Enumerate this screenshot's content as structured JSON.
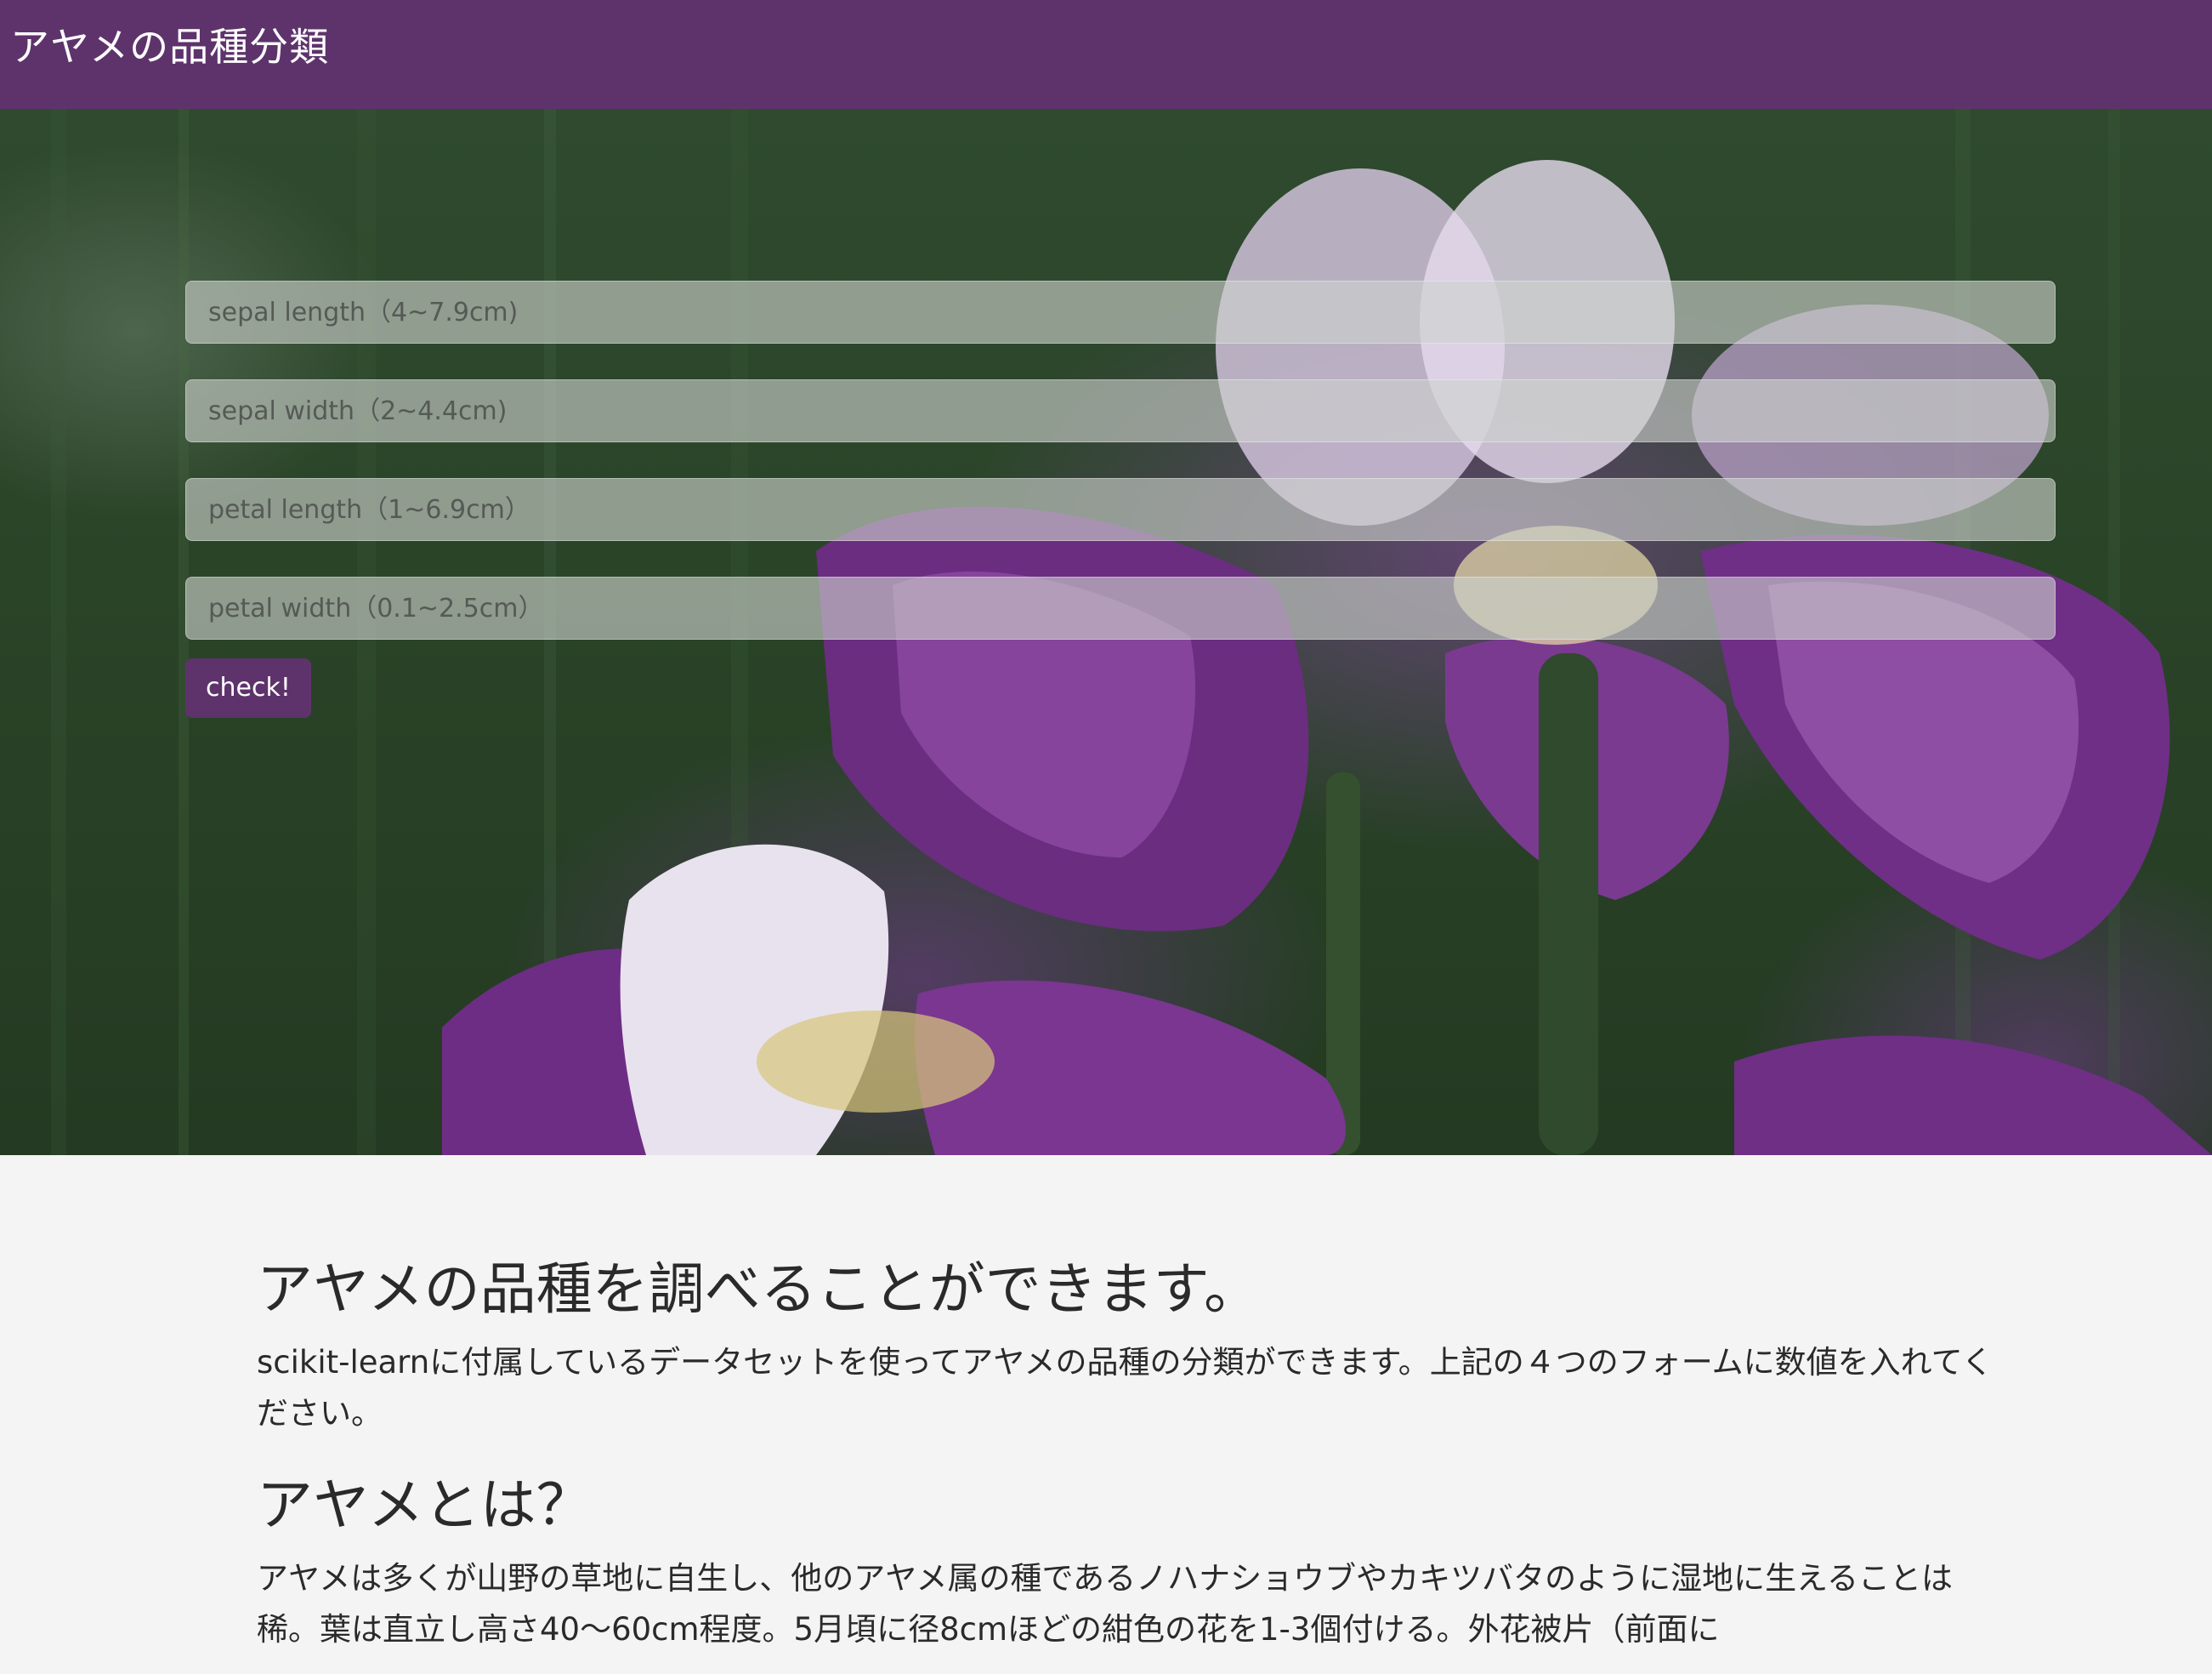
{
  "navbar": {
    "brand": "アヤメの品種分類"
  },
  "form": {
    "fields": [
      {
        "placeholder": "sepal length（4~7.9cm)",
        "value": ""
      },
      {
        "placeholder": "sepal width（2~4.4cm)",
        "value": ""
      },
      {
        "placeholder": "petal length（1~6.9cm）",
        "value": ""
      },
      {
        "placeholder": "petal width（0.1~2.5cm）",
        "value": ""
      }
    ],
    "submit_label": "check!"
  },
  "content": {
    "heading": "アヤメの品種を調べることができます。",
    "intro": "scikit-learnに付属しているデータセットを使ってアヤメの品種の分類ができます。上記の４つのフォームに数値を入れてください。",
    "subheading": "アヤメとは？",
    "description": "アヤメは多くが山野の草地に自生し、他のアヤメ属の種であるノハナショウブやカキツバタのように湿地に生えることは稀。葉は直立し高さ40〜60cm程度。5月頃に径8cmほどの紺色の花を1-3個付ける。外花被片（前面に"
  },
  "colors": {
    "primary": "#5e336c",
    "background": "#f4f4f4"
  }
}
